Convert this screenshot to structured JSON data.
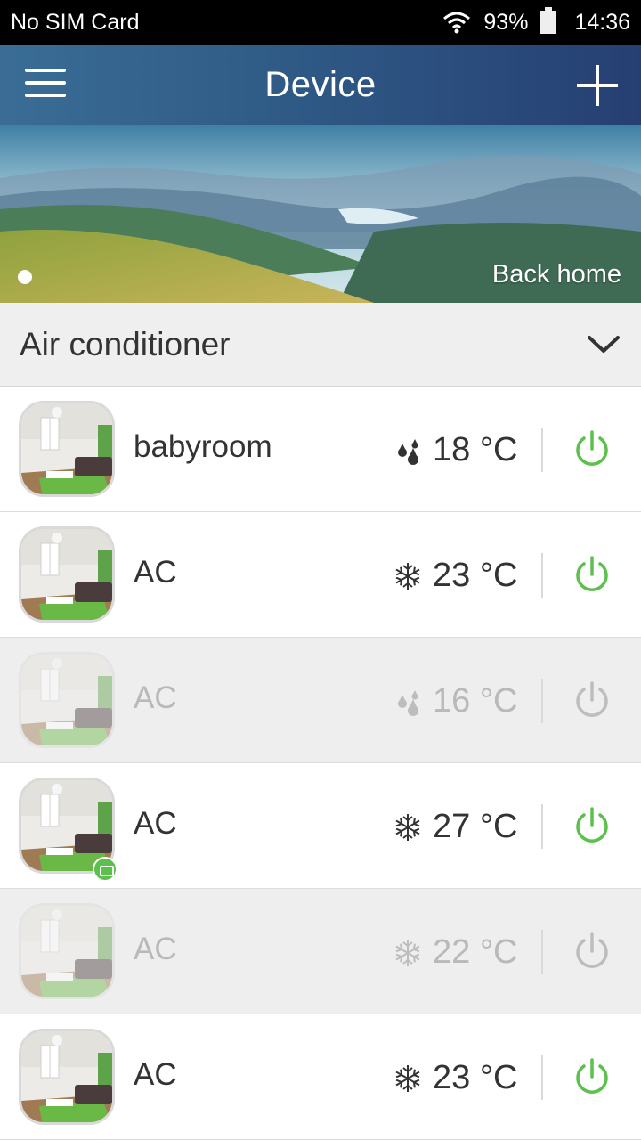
{
  "status_bar": {
    "carrier": "No SIM Card",
    "battery": "93%",
    "time": "14:36"
  },
  "header": {
    "title": "Device",
    "menu_icon": "hamburger-menu-icon",
    "add_icon": "plus-icon"
  },
  "banner": {
    "link_label": "Back home",
    "image": "mountain-landscape"
  },
  "category": {
    "title": "Air conditioner",
    "icon": "chevron-down-icon"
  },
  "devices": [
    {
      "name": "babyroom",
      "mode": "dry",
      "mode_icon": "drops-icon",
      "temperature": "18 °C",
      "online": true,
      "badge": false
    },
    {
      "name": "AC",
      "mode": "cool",
      "mode_icon": "snowflake-icon",
      "temperature": "23 °C",
      "online": true,
      "badge": false
    },
    {
      "name": "AC",
      "mode": "dry",
      "mode_icon": "drops-icon",
      "temperature": "16 °C",
      "online": false,
      "badge": false
    },
    {
      "name": "AC",
      "mode": "cool",
      "mode_icon": "snowflake-icon",
      "temperature": "27 °C",
      "online": true,
      "badge": true
    },
    {
      "name": "AC",
      "mode": "cool",
      "mode_icon": "snowflake-icon",
      "temperature": "22 °C",
      "online": false,
      "badge": false
    },
    {
      "name": "AC",
      "mode": "cool",
      "mode_icon": "snowflake-icon",
      "temperature": "23 °C",
      "online": true,
      "badge": false
    }
  ],
  "colors": {
    "header_bg": "#2f5a86",
    "power_on": "#5cc04c",
    "power_off": "#bdbdbd",
    "text": "#333333",
    "text_disabled": "#b9b9b9"
  }
}
